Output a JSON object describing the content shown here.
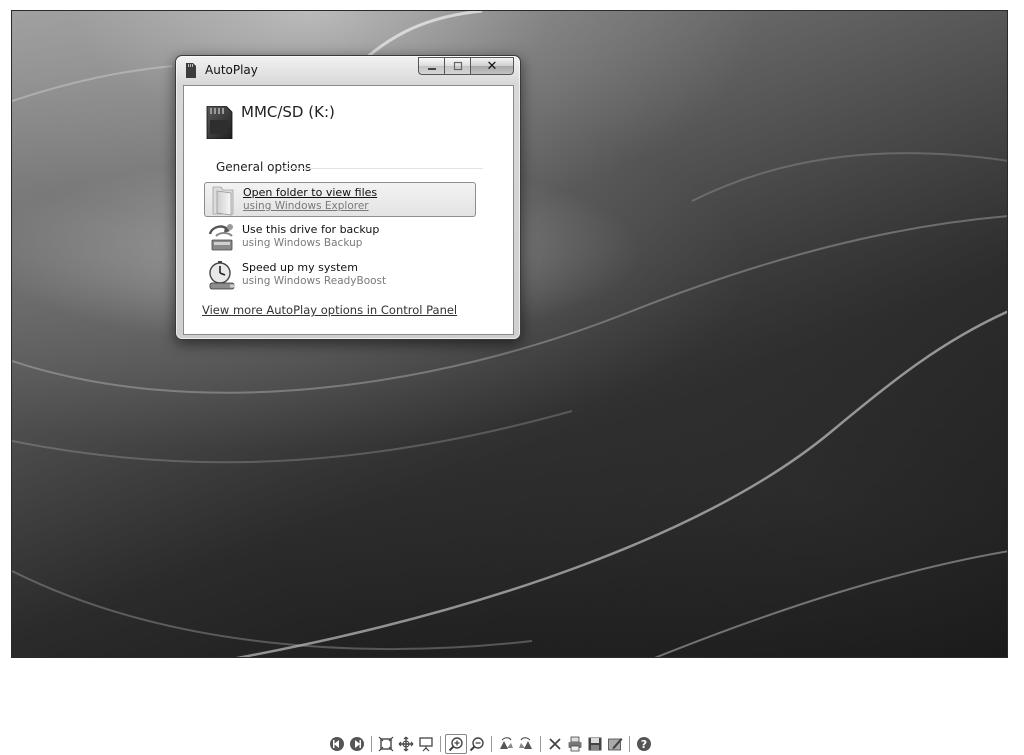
{
  "window": {
    "title": "AutoPlay",
    "icon": "sd-card-icon",
    "caption_buttons": {
      "minimize": "minimize-icon",
      "maximize": "maximize-icon",
      "close_glyph": "✕"
    }
  },
  "device": {
    "name": "MMC/SD (K:)",
    "icon": "sd-card-icon"
  },
  "general_options": {
    "label": "General options",
    "items": [
      {
        "title": "Open folder to view files",
        "subtitle": "using Windows Explorer",
        "icon": "folder-icon",
        "selected": true
      },
      {
        "title": "Use this drive for backup",
        "subtitle": "using Windows Backup",
        "icon": "backup-icon",
        "selected": false
      },
      {
        "title": "Speed up my system",
        "subtitle": "using Windows ReadyBoost",
        "icon": "readyboost-icon",
        "selected": false
      }
    ]
  },
  "footer_link": "View more AutoPlay options in Control Panel",
  "toolbar": {
    "buttons": [
      "previous-icon",
      "next-icon",
      "fit-to-window-icon",
      "actual-size-icon",
      "slideshow-icon",
      "zoom-in-icon",
      "zoom-out-icon",
      "rotate-clockwise-icon",
      "rotate-counterclockwise-icon",
      "delete-icon",
      "print-icon",
      "save-icon",
      "edit-icon",
      "help-icon"
    ],
    "active": "zoom-in-icon"
  },
  "colors": {
    "selection_fill": "#e6e6e6",
    "selection_border": "#8d8d8d",
    "subtitle_text": "#7a7a7a"
  }
}
